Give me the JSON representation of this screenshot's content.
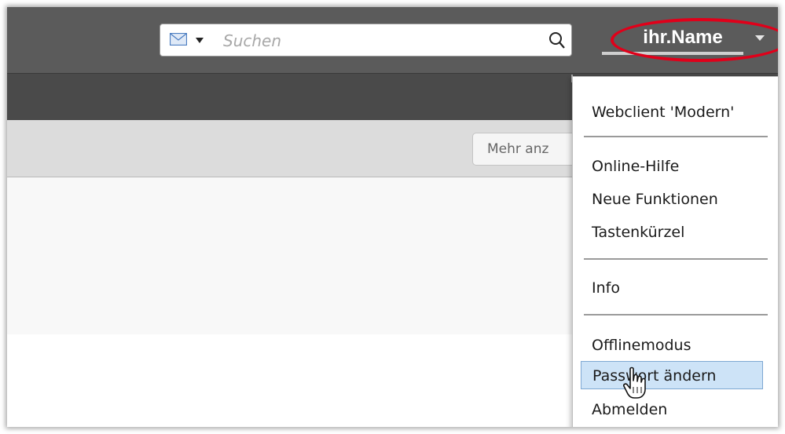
{
  "search": {
    "placeholder": "Suchen",
    "mail_icon": "mail-icon",
    "search_icon": "magnifier-icon"
  },
  "user": {
    "name": "ihr.Name"
  },
  "toolbar": {
    "more_label": "Mehr anz"
  },
  "menu": {
    "items": [
      {
        "label": "Webclient 'Modern'"
      },
      {
        "label": "Online-Hilfe"
      },
      {
        "label": "Neue Funktionen"
      },
      {
        "label": "Tastenkürzel"
      },
      {
        "label": "Info"
      },
      {
        "label": "Offlinemodus"
      },
      {
        "label": "Passwort ändern"
      },
      {
        "label": "Abmelden"
      }
    ],
    "active_item": "Passwort ändern"
  },
  "colors": {
    "topbar": "#5b5b5b",
    "subbar": "#4a4a4a",
    "highlight_ellipse": "#e0001a",
    "menu_active_bg": "#cde3f7"
  }
}
